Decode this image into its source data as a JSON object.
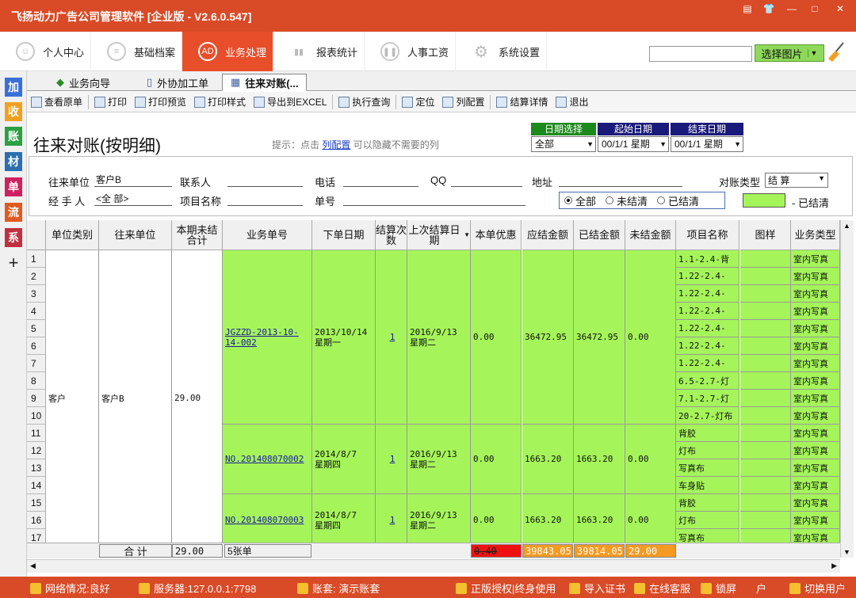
{
  "app": {
    "title": "飞扬动力广告公司管理软件 [企业版 - V2.6.0.547]"
  },
  "window_buttons": [
    "▤",
    "👕",
    "—",
    "□",
    "✕"
  ],
  "nav": [
    {
      "label": "个人中心",
      "icon": "user-icon"
    },
    {
      "label": "基础档案",
      "icon": "list-icon"
    },
    {
      "label": "业务处理",
      "icon": "AD"
    },
    {
      "label": "报表统计",
      "icon": "chart-icon"
    },
    {
      "label": "人事工资",
      "icon": "pause-icon"
    },
    {
      "label": "系统设置",
      "icon": "gear-icon"
    }
  ],
  "search": {
    "value": "",
    "select_image_label": "选择图片"
  },
  "sidebar": [
    {
      "label": "加",
      "color": "#3a6fd8"
    },
    {
      "label": "收",
      "color": "#f0a020"
    },
    {
      "label": "账",
      "color": "#2aa040"
    },
    {
      "label": "材",
      "color": "#2a70b0"
    },
    {
      "label": "单",
      "color": "#d02060"
    },
    {
      "label": "流",
      "color": "#e05a20"
    },
    {
      "label": "系",
      "color": "#c03040"
    },
    {
      "label": "+",
      "color": "#f0f0f0"
    }
  ],
  "tabs": [
    "业务向导",
    "外协加工单",
    "往来对账(..."
  ],
  "toolbar": [
    "查看原单",
    "打印",
    "打印预览",
    "打印样式",
    "导出到EXCEL",
    "执行查询",
    "定位",
    "列配置",
    "结算详情",
    "退出"
  ],
  "page": {
    "heading": "往来对账(按明细)",
    "hint_prefix": "提示：点击",
    "hint_link": "列配置",
    "hint_suffix": "可以隐藏不需要的列"
  },
  "dates": {
    "headers": [
      "日期选择",
      "起始日期",
      "结束日期"
    ],
    "values": [
      "全部",
      "00/1/1 星期",
      "00/1/1 星期"
    ]
  },
  "filter": {
    "labels": [
      "往来单位",
      "联系人",
      "电话",
      "QQ",
      "地址",
      "对账类型",
      "经 手 人",
      "项目名称",
      "单号"
    ],
    "partner": "客户B",
    "handler": "<全 部>",
    "recon_type": "结 算",
    "radios": [
      "全部",
      "未结清",
      "已结清"
    ],
    "legend": "已结清"
  },
  "columns": [
    "单位类别",
    "往来单位",
    "本期未结合计",
    "业务单号",
    "下单日期",
    "结算次数",
    "上次结算日期",
    "本单优惠",
    "应结金额",
    "已结金额",
    "未结金额",
    "项目名称",
    "图样",
    "业务类型"
  ],
  "rows": {
    "unit_type": "客户",
    "partner": "客户B",
    "unsettled_total": "29.00",
    "orders": [
      {
        "no": "JGZZD-2013-10-14-002",
        "date": "2013/10/14",
        "weekday": "星期一",
        "count": "1",
        "last_date": "2016/9/13",
        "last_weekday": "星期二",
        "discount": "0.00",
        "due": "36472.95",
        "paid": "36472.95",
        "unpaid": "0.00"
      },
      {
        "no": "NO.201408070002",
        "date": "2014/8/7",
        "weekday": "星期四",
        "count": "1",
        "last_date": "2016/9/13",
        "last_weekday": "星期二",
        "discount": "0.00",
        "due": "1663.20",
        "paid": "1663.20",
        "unpaid": "0.00"
      },
      {
        "no": "NO.201408070003",
        "date": "2014/8/7",
        "weekday": "星期四",
        "count": "1",
        "last_date": "2016/9/13",
        "last_weekday": "星期二",
        "discount": "0.00",
        "due": "1663.20",
        "paid": "1663.20",
        "unpaid": "0.00"
      }
    ],
    "items": [
      "1.1-2.4-背",
      "1.22-2.4-",
      "1.22-2.4-",
      "1.22-2.4-",
      "1.22-2.4-",
      "1.22-2.4-",
      "1.22-2.4-",
      "6.5-2.7-灯",
      "7.1-2.7-灯",
      "20-2.7-灯布",
      "背胶",
      "灯布",
      "写真布",
      "车身贴",
      "背胶",
      "灯布",
      "写真布"
    ],
    "biz_type": "室内写真"
  },
  "totals": {
    "label": "合 计",
    "unsettled": "29.00",
    "orders": "5张单",
    "discount": "0.40",
    "due": "39843.05",
    "paid": "39814.05",
    "unpaid": "29.00"
  },
  "status": {
    "network": "网络情况:良好",
    "server": "服务器:127.0.0.1:7798",
    "account": "账套: 演示账套",
    "license": "正版授权|终身使用",
    "import_cert": "导入证书",
    "online": "在线客服",
    "lock": "锁屏",
    "user": "户",
    "switch_user": "切换用户"
  }
}
